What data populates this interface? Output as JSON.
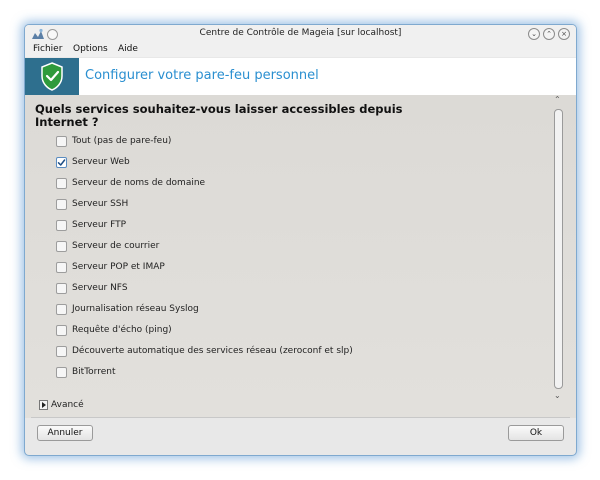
{
  "window": {
    "title": "Centre de Contrôle de Mageia  [sur localhost]"
  },
  "menu": [
    {
      "label": "Fichier"
    },
    {
      "label": "Options"
    },
    {
      "label": "Aide"
    }
  ],
  "banner": {
    "title": "Configurer votre pare-feu personnel",
    "icon": "shield-check-icon"
  },
  "question": "Quels services souhaitez-vous laisser accessibles depuis Internet ?",
  "options": [
    {
      "label": "Tout (pas de pare-feu)",
      "checked": false
    },
    {
      "label": "Serveur Web",
      "checked": true
    },
    {
      "label": "Serveur de noms de domaine",
      "checked": false
    },
    {
      "label": "Serveur SSH",
      "checked": false
    },
    {
      "label": "Serveur FTP",
      "checked": false
    },
    {
      "label": "Serveur de courrier",
      "checked": false
    },
    {
      "label": "Serveur POP et IMAP",
      "checked": false
    },
    {
      "label": "Serveur NFS",
      "checked": false
    },
    {
      "label": "Journalisation réseau Syslog",
      "checked": false
    },
    {
      "label": "Requête d'écho (ping)",
      "checked": false
    },
    {
      "label": "Découverte automatique des services réseau (zeroconf et slp)",
      "checked": false
    },
    {
      "label": "BitTorrent",
      "checked": false
    }
  ],
  "advanced": {
    "label": "Avancé"
  },
  "buttons": {
    "cancel": "Annuler",
    "ok": "Ok"
  },
  "colors": {
    "accent": "#2a8fd0",
    "banner_icon_bg": "#2e6f8e",
    "shield": "#2f9a3c",
    "glow": "#5a96d2"
  }
}
